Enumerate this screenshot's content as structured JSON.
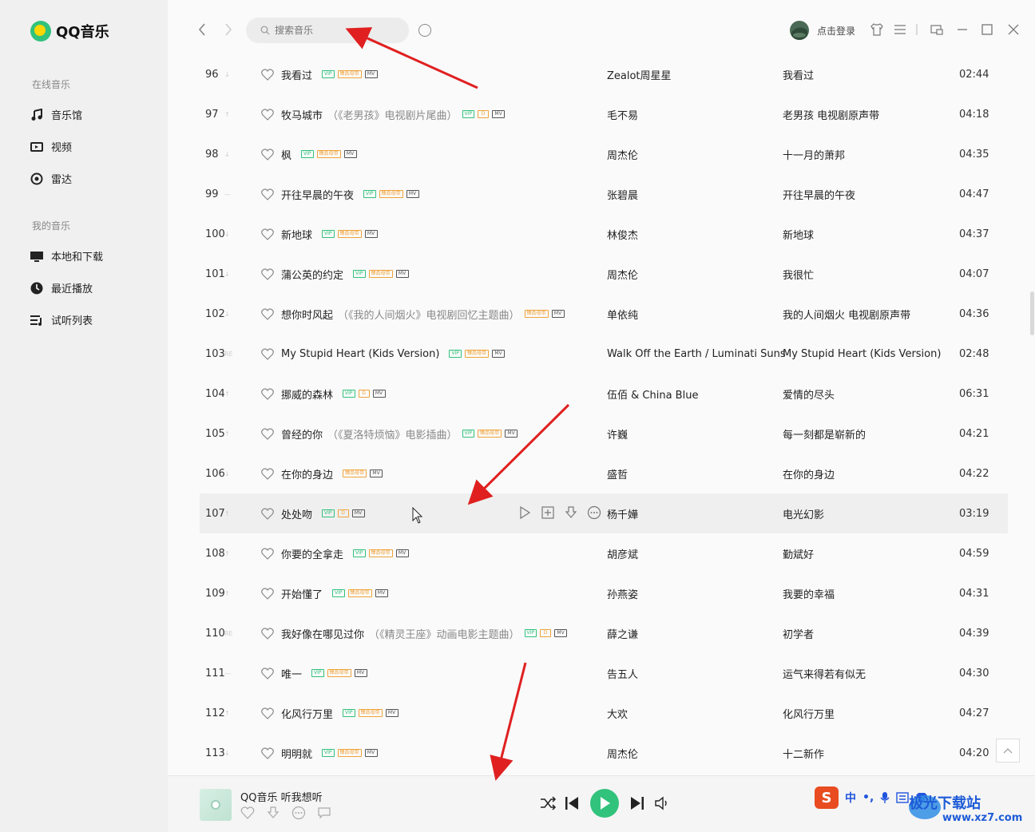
{
  "app": {
    "logo_text": "QQ音乐"
  },
  "sidebar": {
    "group_online": "在线音乐",
    "group_mine": "我的音乐",
    "online_items": [
      {
        "label": "音乐馆",
        "icon": "music-note-icon"
      },
      {
        "label": "视频",
        "icon": "video-icon"
      },
      {
        "label": "雷达",
        "icon": "radar-icon"
      }
    ],
    "mine_items": [
      {
        "label": "本地和下载",
        "icon": "monitor-icon"
      },
      {
        "label": "最近播放",
        "icon": "clock-icon"
      },
      {
        "label": "试听列表",
        "icon": "playlist-icon"
      }
    ]
  },
  "topbar": {
    "search_placeholder": "搜索音乐",
    "login_label": "点击登录"
  },
  "tracks": [
    {
      "num": "96",
      "trend": "↓",
      "title": "我看过",
      "subtitle": "",
      "tags": [
        "VIP",
        "臻品母带",
        "MV"
      ],
      "artist": "Zealot周星星",
      "album": "我看过",
      "duration": "02:44"
    },
    {
      "num": "97",
      "trend": "↑",
      "title": "牧马城市",
      "subtitle": "（《老男孩》电视剧片尾曲）",
      "tags": [
        "VIP",
        "D",
        "MV"
      ],
      "artist": "毛不易",
      "album": "老男孩 电视剧原声带",
      "duration": "04:18"
    },
    {
      "num": "98",
      "trend": "↓",
      "title": "枫",
      "subtitle": "",
      "tags": [
        "VIP",
        "臻品母带",
        "MV"
      ],
      "artist": "周杰伦",
      "album": "十一月的萧邦",
      "duration": "04:35"
    },
    {
      "num": "99",
      "trend": "—",
      "title": "开往早晨的午夜",
      "subtitle": "",
      "tags": [
        "VIP",
        "臻品母带",
        "MV"
      ],
      "artist": "张碧晨",
      "album": "开往早晨的午夜",
      "duration": "04:47"
    },
    {
      "num": "100",
      "trend": "↓",
      "title": "新地球",
      "subtitle": "",
      "tags": [
        "VIP",
        "臻品母带",
        "MV"
      ],
      "artist": "林俊杰",
      "album": "新地球",
      "duration": "04:37"
    },
    {
      "num": "101",
      "trend": "↓",
      "title": "蒲公英的约定",
      "subtitle": "",
      "tags": [
        "VIP",
        "臻品母带",
        "MV"
      ],
      "artist": "周杰伦",
      "album": "我很忙",
      "duration": "04:07"
    },
    {
      "num": "102",
      "trend": "↓",
      "title": "想你时风起",
      "subtitle": "（《我的人间烟火》电视剧回忆主题曲）",
      "tags": [
        "臻品母带",
        "MV"
      ],
      "artist": "单依纯",
      "album": "我的人间烟火 电视剧原声带",
      "duration": "04:36"
    },
    {
      "num": "103",
      "trend": "RE",
      "title": "My Stupid Heart (Kids Version)",
      "subtitle": "",
      "tags": [
        "VIP",
        "臻品母带",
        "MV"
      ],
      "artist": "Walk Off the Earth / Luminati Suns",
      "album": "My Stupid Heart (Kids Version)",
      "duration": "02:48"
    },
    {
      "num": "104",
      "trend": "↑",
      "title": "挪威的森林",
      "subtitle": "",
      "tags": [
        "VIP",
        "D",
        "MV"
      ],
      "artist": "伍佰 & China Blue",
      "album": "爱情的尽头",
      "duration": "06:31"
    },
    {
      "num": "105",
      "trend": "↑",
      "title": "曾经的你",
      "subtitle": "（《夏洛特烦恼》电影插曲）",
      "tags": [
        "VIP",
        "臻品母带",
        "MV"
      ],
      "artist": "许巍",
      "album": "每一刻都是崭新的",
      "duration": "04:21"
    },
    {
      "num": "106",
      "trend": "↓",
      "title": "在你的身边",
      "subtitle": "",
      "tags": [
        "臻品母带",
        "MV"
      ],
      "artist": "盛哲",
      "album": "在你的身边",
      "duration": "04:22"
    },
    {
      "num": "107",
      "trend": "↑",
      "title": "处处吻",
      "subtitle": "",
      "tags": [
        "VIP",
        "D",
        "MV"
      ],
      "artist": "杨千嬅",
      "album": "电光幻影",
      "duration": "03:19",
      "hover": true
    },
    {
      "num": "108",
      "trend": "↑",
      "title": "你要的全拿走",
      "subtitle": "",
      "tags": [
        "VIP",
        "臻品母带",
        "MV"
      ],
      "artist": "胡彦斌",
      "album": "勤斌好",
      "duration": "04:59"
    },
    {
      "num": "109",
      "trend": "↑",
      "title": "开始懂了",
      "subtitle": "",
      "tags": [
        "VIP",
        "臻品母带",
        "MV"
      ],
      "artist": "孙燕姿",
      "album": "我要的幸福",
      "duration": "04:31"
    },
    {
      "num": "110",
      "trend": "RE",
      "title": "我好像在哪见过你",
      "subtitle": "（《精灵王座》动画电影主题曲）",
      "tags": [
        "VIP",
        "D",
        "MV"
      ],
      "artist": "薛之谦",
      "album": "初学者",
      "duration": "04:39"
    },
    {
      "num": "111",
      "trend": "—",
      "title": "唯一",
      "subtitle": "",
      "tags": [
        "VIP",
        "臻品母带",
        "MV"
      ],
      "artist": "告五人",
      "album": "运气来得若有似无",
      "duration": "04:30"
    },
    {
      "num": "112",
      "trend": "↑",
      "title": "化风行万里",
      "subtitle": "",
      "tags": [
        "VIP",
        "臻品母带",
        "MV"
      ],
      "artist": "大欢",
      "album": "化风行万里",
      "duration": "04:27"
    },
    {
      "num": "113",
      "trend": "↓",
      "title": "明明就",
      "subtitle": "",
      "tags": [
        "VIP",
        "臻品母带",
        "MV"
      ],
      "artist": "周杰伦",
      "album": "十二新作",
      "duration": "04:20"
    }
  ],
  "player": {
    "now_playing": "QQ音乐 听我想听"
  },
  "ime": {
    "lang": "中"
  },
  "watermark": {
    "line1": "极光下载站",
    "line2": "www.xz7.com"
  },
  "colors": {
    "accent": "#31c27c",
    "arrow": "#e02020"
  }
}
